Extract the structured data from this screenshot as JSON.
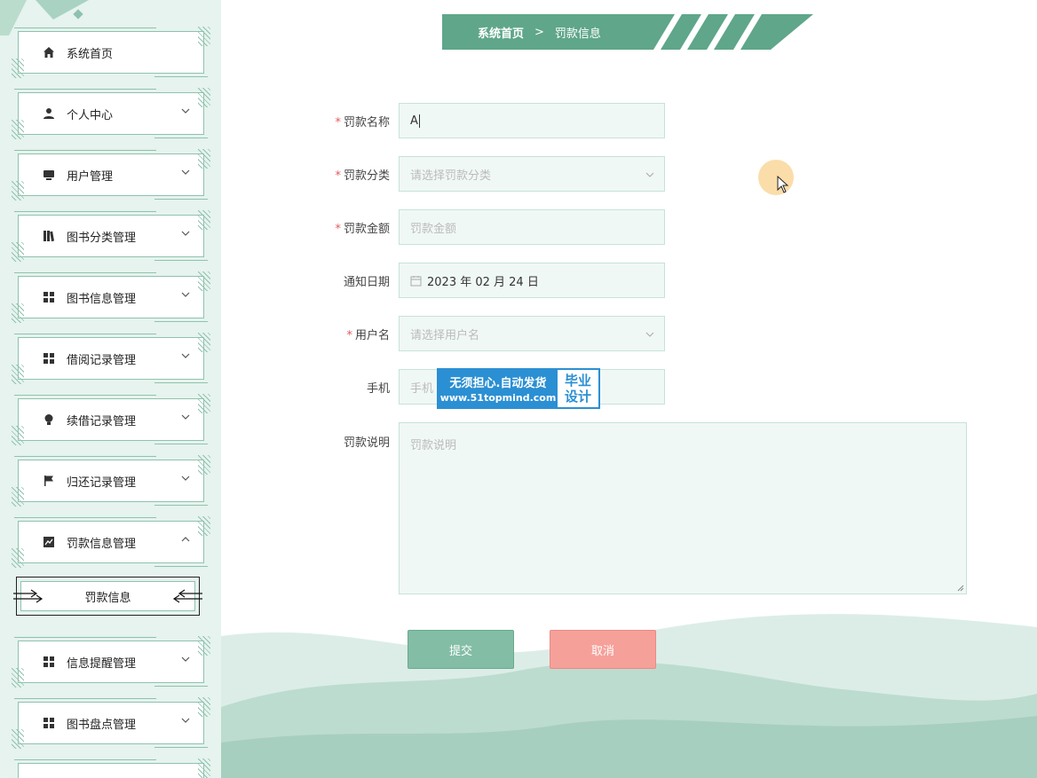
{
  "sidebar": {
    "items": [
      {
        "label": "系统首页",
        "icon": "home-icon",
        "expandable": false
      },
      {
        "label": "个人中心",
        "icon": "person-icon",
        "expandable": true
      },
      {
        "label": "用户管理",
        "icon": "user-manage-icon",
        "expandable": true
      },
      {
        "label": "图书分类管理",
        "icon": "library-icon",
        "expandable": true
      },
      {
        "label": "图书信息管理",
        "icon": "grid-icon",
        "expandable": true
      },
      {
        "label": "借阅记录管理",
        "icon": "grid-icon",
        "expandable": true
      },
      {
        "label": "续借记录管理",
        "icon": "lightbulb-icon",
        "expandable": true
      },
      {
        "label": "归还记录管理",
        "icon": "flag-icon",
        "expandable": true
      },
      {
        "label": "罚款信息管理",
        "icon": "chart-icon",
        "expandable": true,
        "expanded": true
      },
      {
        "label": "信息提醒管理",
        "icon": "grid-icon",
        "expandable": true
      },
      {
        "label": "图书盘点管理",
        "icon": "grid-icon",
        "expandable": true
      }
    ],
    "sub_item": "罚款信息"
  },
  "breadcrumb": {
    "home": "系统首页",
    "separator": ">",
    "current": "罚款信息"
  },
  "form": {
    "fine_name": {
      "label": "罚款名称",
      "value": "A",
      "required": true
    },
    "fine_category": {
      "label": "罚款分类",
      "placeholder": "请选择罚款分类",
      "required": true
    },
    "fine_amount": {
      "label": "罚款金额",
      "placeholder": "罚款金额",
      "required": true
    },
    "notify_date": {
      "label": "通知日期",
      "value": "2023 年 02 月 24 日",
      "required": false
    },
    "username": {
      "label": "用户名",
      "placeholder": "请选择用户名",
      "required": true
    },
    "phone": {
      "label": "手机",
      "placeholder": "手机",
      "required": false
    },
    "description": {
      "label": "罚款说明",
      "placeholder": "罚款说明",
      "required": false
    },
    "required_mark": "*"
  },
  "buttons": {
    "submit": "提交",
    "cancel": "取消"
  },
  "watermark": {
    "line1": "无须担心.自动发货",
    "line2": "www.51topmind.com",
    "right1": "毕业",
    "right2": "设计"
  },
  "colors": {
    "accent": "#5fa68a",
    "sidebar_bg": "#e6f3ee",
    "cancel": "#f6a09a",
    "submit": "#83bda6"
  }
}
